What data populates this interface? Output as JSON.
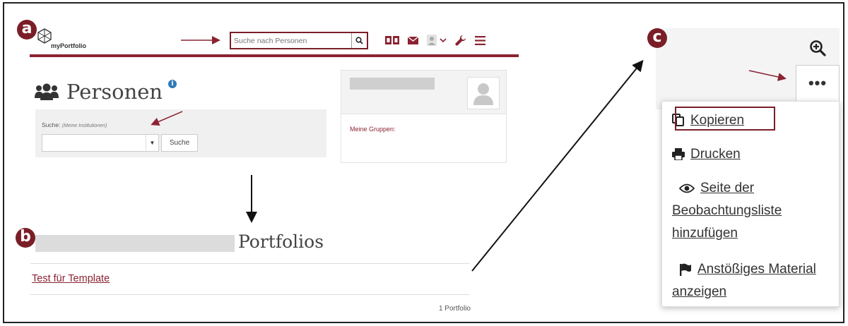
{
  "badges": {
    "a": "a",
    "b": "b",
    "c": "c"
  },
  "header": {
    "logo_text": "myPortfolio",
    "search_placeholder": "Suche nach Personen"
  },
  "personen": {
    "title": "Personen",
    "info_icon": "i",
    "search_label": "Suche:",
    "search_scope": "(Meine Institutionen)",
    "search_button": "Suche",
    "groups_label": "Meine Gruppen:"
  },
  "portfolios": {
    "title": "Portfolios",
    "link": "Test für Template",
    "count": "1 Portfolio"
  },
  "menu": {
    "more_button": "•••",
    "items": [
      {
        "label": "Kopieren",
        "icon": "copy-icon"
      },
      {
        "label": "Drucken",
        "icon": "print-icon"
      },
      {
        "label": "Seite der Beobachtungsliste hinzufügen",
        "icon": "eye-icon"
      },
      {
        "label": "Anstößiges Material anzeigen",
        "icon": "flag-icon"
      }
    ]
  },
  "colors": {
    "accent": "#8b2332",
    "badge": "#7a1e28",
    "info": "#2f79b7"
  }
}
